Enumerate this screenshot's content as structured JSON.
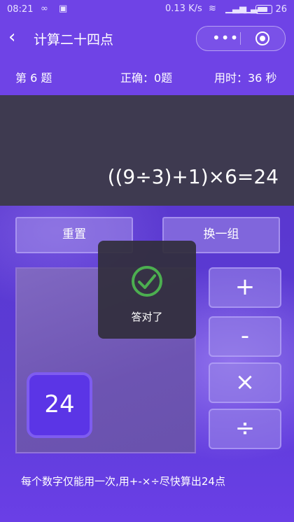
{
  "statusbar": {
    "time": "08:21",
    "speed": "0.13 K/s",
    "battery": "26"
  },
  "navbar": {
    "back_icon": "‹",
    "title": "计算二十四点",
    "more_icon": "•••"
  },
  "info": {
    "question": "第 6 题",
    "correct": "正确：0题",
    "time_used": "用时：36 秒"
  },
  "display": {
    "expression": "((9÷3)+1)×6=24"
  },
  "buttons": {
    "reset": "重置",
    "new_group": "换一组"
  },
  "board": {
    "cards": [
      "24"
    ]
  },
  "operators": [
    "+",
    "-",
    "×",
    "÷"
  ],
  "toast": {
    "message": "答对了"
  },
  "hint": "每个数字仅能用一次,用+-×÷尽快算出24点",
  "colors": {
    "header": "#6f43e6",
    "display_bg": "#3e3a50",
    "card": "#5b35e6",
    "check_green": "#4caf50"
  }
}
